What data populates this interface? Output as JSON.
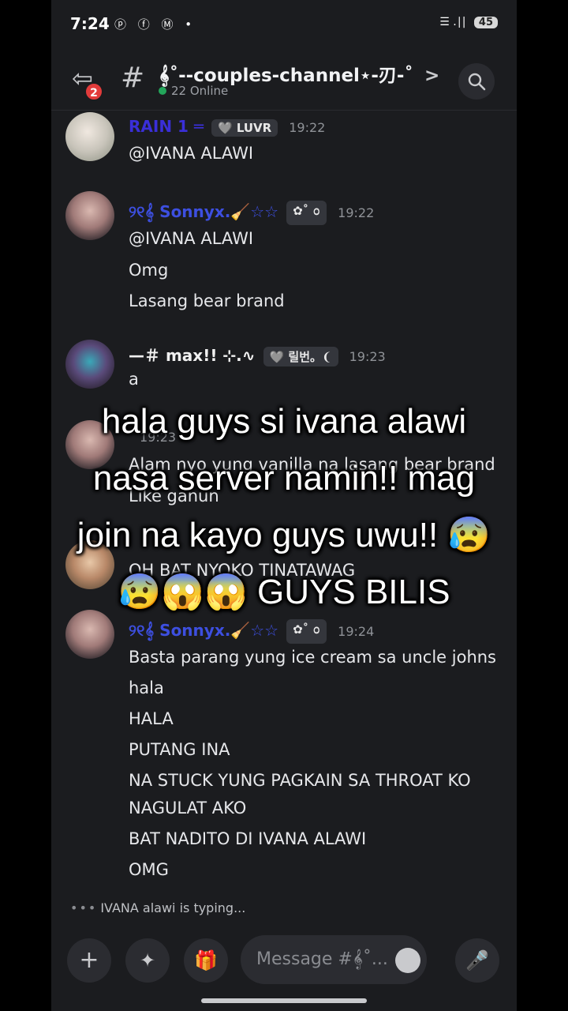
{
  "status_bar": {
    "time": "7:24",
    "icons": "ⓟ ⓕ Ⓜ •",
    "signal": "☰ .∣|",
    "battery": "45"
  },
  "header": {
    "back_badge": "2",
    "channel_name": "𝄞⃘˚--couples-channel⋆-刃-˚",
    "chevron": ">",
    "online": "22 Online"
  },
  "messages": [
    {
      "name": "RAIN 1 ═",
      "name_color": "#3a2fd8",
      "tag": "🩶 LUVR",
      "time": "19:22",
      "lines": [
        "@IVANA ALAWI"
      ]
    },
    {
      "name": "୨୧𝄞 Sonnyx.🧹☆☆",
      "name_color": "#3d4fe0",
      "tag": "✿˚ ᭵",
      "time": "19:22",
      "lines": [
        "@IVANA ALAWI",
        "Omg",
        "Lasang bear brand"
      ]
    },
    {
      "name": "—＃ max!! ⊹.∿",
      "name_color": "#f0f0f0",
      "tag": "🩶 릴번。❨",
      "time": "19:23",
      "lines": [
        "a"
      ]
    },
    {
      "name": "",
      "name_color": "#3d4fe0",
      "tag": "",
      "time": "19:23",
      "lines": [
        "Alam nyo yung vanilla na lasang bear brand",
        "Like ganun"
      ]
    },
    {
      "name": "",
      "name_color": "#f0f0f0",
      "tag": "",
      "time": "",
      "lines": [
        "OH BAT NYOKO TINATAWAG"
      ]
    },
    {
      "name": "୨୧𝄞 Sonnyx.🧹☆☆",
      "name_color": "#3d4fe0",
      "tag": "✿˚ ᭵",
      "time": "19:24",
      "lines": [
        "Basta parang yung ice cream sa uncle johns",
        "hala",
        "HALA",
        "PUTANG INA",
        "NA STUCK YUNG PAGKAIN SA THROAT KO",
        "NAGULAT AKO",
        "BAT NADITO DI IVANA ALAWI",
        "OMG"
      ]
    }
  ],
  "overlay": {
    "line1": "hala guys si ivana alawi",
    "line2": "nasa server namin!! mag",
    "line3": "join na kayo guys uwu!! 😰",
    "line4": "😰😱😱 GUYS BILIS"
  },
  "typing": "IVANA alawi is typing...",
  "composer": {
    "placeholder": "Message #𝄞⃘˚..."
  }
}
